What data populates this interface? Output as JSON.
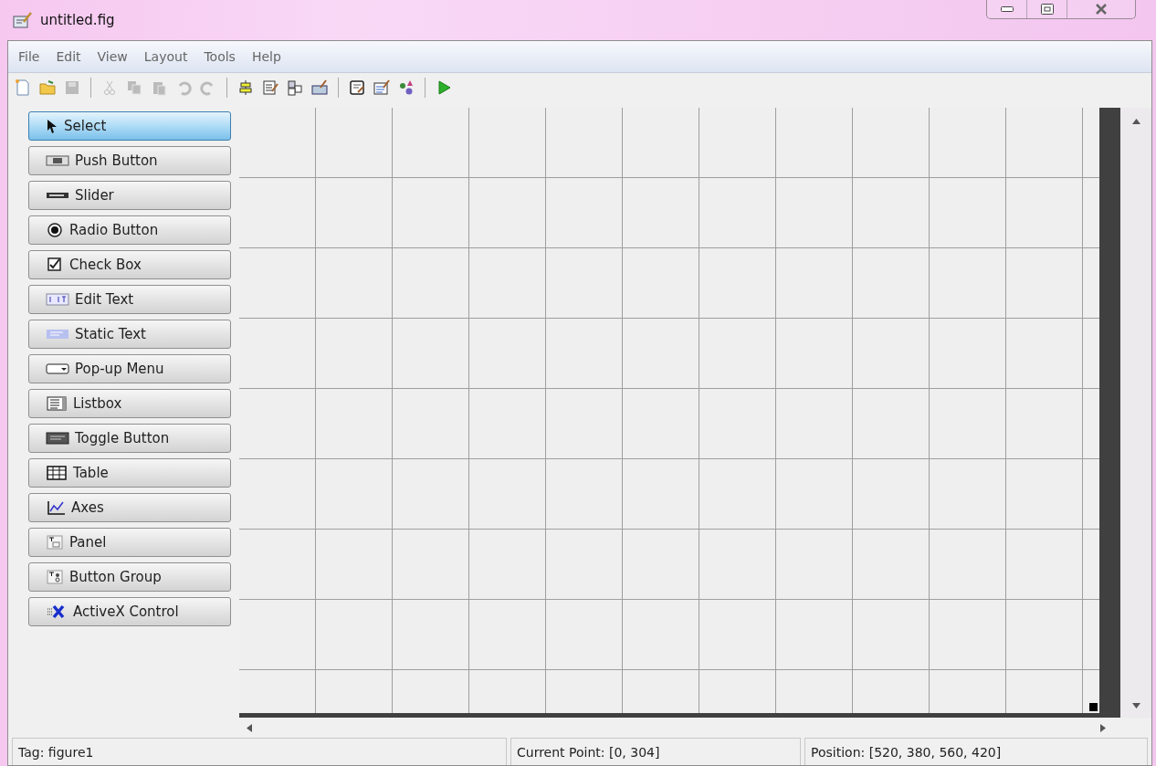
{
  "window": {
    "title": "untitled.fig"
  },
  "menu": [
    "File",
    "Edit",
    "View",
    "Layout",
    "Tools",
    "Help"
  ],
  "toolbar": [
    {
      "kind": "new",
      "disabled": false
    },
    {
      "kind": "open",
      "disabled": false
    },
    {
      "kind": "save",
      "disabled": true
    },
    {
      "kind": "sep"
    },
    {
      "kind": "cut",
      "disabled": true
    },
    {
      "kind": "copy",
      "disabled": true
    },
    {
      "kind": "paste",
      "disabled": true
    },
    {
      "kind": "undo",
      "disabled": true
    },
    {
      "kind": "redo",
      "disabled": true
    },
    {
      "kind": "sep"
    },
    {
      "kind": "align",
      "disabled": false
    },
    {
      "kind": "menu",
      "disabled": false
    },
    {
      "kind": "taborder",
      "disabled": false
    },
    {
      "kind": "toolbar",
      "disabled": false
    },
    {
      "kind": "sep"
    },
    {
      "kind": "editor",
      "disabled": false
    },
    {
      "kind": "inspector",
      "disabled": false
    },
    {
      "kind": "browser",
      "disabled": false
    },
    {
      "kind": "sep"
    },
    {
      "kind": "run",
      "disabled": false
    }
  ],
  "palette": [
    {
      "label": "Select",
      "kind": "select",
      "selected": true
    },
    {
      "label": "Push Button",
      "kind": "push",
      "selected": false
    },
    {
      "label": "Slider",
      "kind": "slider",
      "selected": false
    },
    {
      "label": "Radio Button",
      "kind": "radio",
      "selected": false
    },
    {
      "label": "Check Box",
      "kind": "check",
      "selected": false
    },
    {
      "label": "Edit Text",
      "kind": "edit",
      "selected": false
    },
    {
      "label": "Static Text",
      "kind": "static",
      "selected": false
    },
    {
      "label": "Pop-up Menu",
      "kind": "popup",
      "selected": false
    },
    {
      "label": "Listbox",
      "kind": "listbox",
      "selected": false
    },
    {
      "label": "Toggle Button",
      "kind": "toggle",
      "selected": false
    },
    {
      "label": "Table",
      "kind": "table",
      "selected": false
    },
    {
      "label": "Axes",
      "kind": "axes",
      "selected": false
    },
    {
      "label": "Panel",
      "kind": "panel",
      "selected": false
    },
    {
      "label": "Button Group",
      "kind": "group",
      "selected": false
    },
    {
      "label": "ActiveX Control",
      "kind": "activex",
      "selected": false
    }
  ],
  "status_bar": {
    "tag": "Tag: figure1",
    "current_point": "Current Point:  [0, 304]",
    "position": "Position: [520, 380, 560, 420]"
  }
}
